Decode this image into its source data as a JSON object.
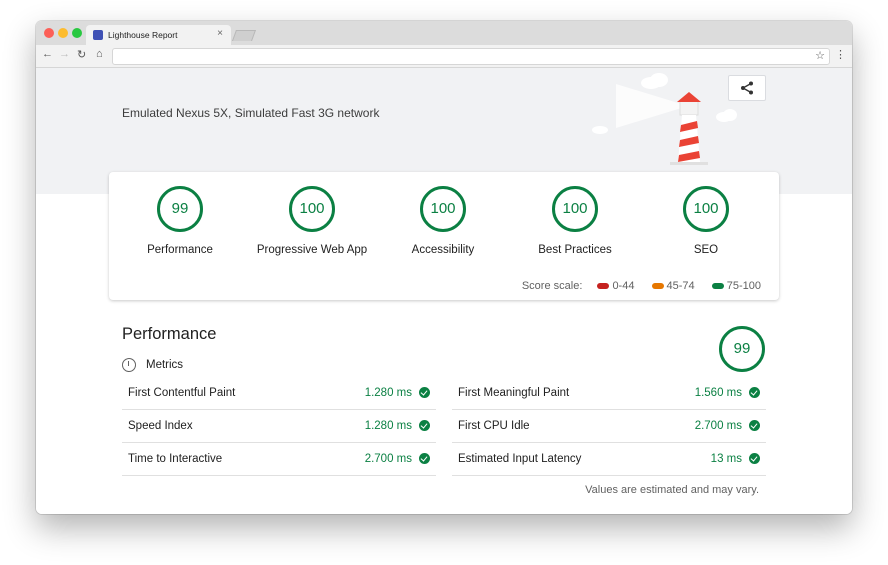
{
  "browser": {
    "tab_title": "Lighthouse Report",
    "tab_close": "×",
    "url": ""
  },
  "header": {
    "environment": "Emulated Nexus 5X, Simulated Fast 3G network"
  },
  "scores": [
    {
      "label": "Performance",
      "value": "99"
    },
    {
      "label": "Progressive Web App",
      "value": "100"
    },
    {
      "label": "Accessibility",
      "value": "100"
    },
    {
      "label": "Best Practices",
      "value": "100"
    },
    {
      "label": "SEO",
      "value": "100"
    }
  ],
  "score_scale": {
    "label": "Score scale:",
    "ranges": [
      {
        "label": "0-44",
        "color": "#c5221f"
      },
      {
        "label": "45-74",
        "color": "#e67700"
      },
      {
        "label": "75-100",
        "color": "#0b8043"
      }
    ]
  },
  "performance": {
    "title": "Performance",
    "score": "99",
    "metrics_label": "Metrics",
    "metrics_left": [
      {
        "label": "First Contentful Paint",
        "value": "1.280 ms"
      },
      {
        "label": "Speed Index",
        "value": "1.280 ms"
      },
      {
        "label": "Time to Interactive",
        "value": "2.700 ms"
      }
    ],
    "metrics_right": [
      {
        "label": "First Meaningful Paint",
        "value": "1.560 ms"
      },
      {
        "label": "First CPU Idle",
        "value": "2.700 ms"
      },
      {
        "label": "Estimated Input Latency",
        "value": "13 ms"
      }
    ],
    "footnote": "Values are estimated and may vary."
  },
  "colors": {
    "pass": "#0b8043",
    "header_bg": "#f1f2f4"
  },
  "icons": [
    "share-icon",
    "lighthouse-illustration",
    "metrics-clock-icon",
    "check-icon"
  ]
}
